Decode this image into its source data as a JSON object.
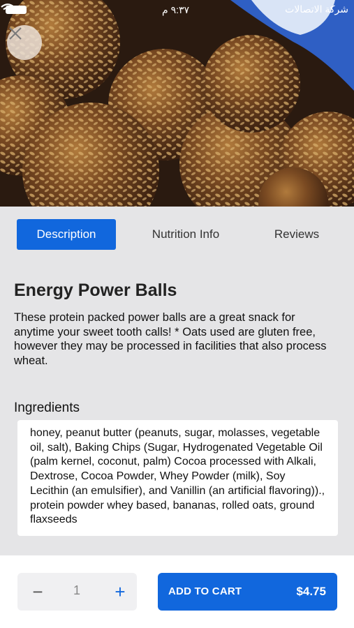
{
  "status_bar": {
    "time": "٩:٣٧ م",
    "carrier": "شركة الاتصالات"
  },
  "hero": {
    "image_description_icon": "energy-balls-photo"
  },
  "tabs": [
    {
      "label": "Description",
      "active": true
    },
    {
      "label": "Nutrition Info",
      "active": false
    },
    {
      "label": "Reviews",
      "active": false
    }
  ],
  "product": {
    "title": "Energy Power Balls",
    "description": "These protein packed power balls are a great snack for anytime your sweet tooth calls! * Oats used are gluten free, however they may be processed in facilities that also process wheat.",
    "ingredients_heading": "Ingredients",
    "ingredients": "honey, peanut butter (peanuts, sugar, molasses, vegetable oil, salt), Baking Chips (Sugar, Hydrogenated Vegetable Oil (palm kernel, coconut, palm) Cocoa processed with Alkali, Dextrose, Cocoa Powder, Whey Powder (milk), Soy Lecithin (an emulsifier), and Vanillin (an artificial flavoring))., protein powder whey based, bananas, rolled oats, ground flaxseeds"
  },
  "cart": {
    "quantity": "1",
    "minus_symbol": "−",
    "plus_symbol": "+",
    "add_label": "ADD TO CART",
    "price": "$4.75"
  },
  "colors": {
    "accent": "#1167dd",
    "background": "#e5e5e7"
  }
}
